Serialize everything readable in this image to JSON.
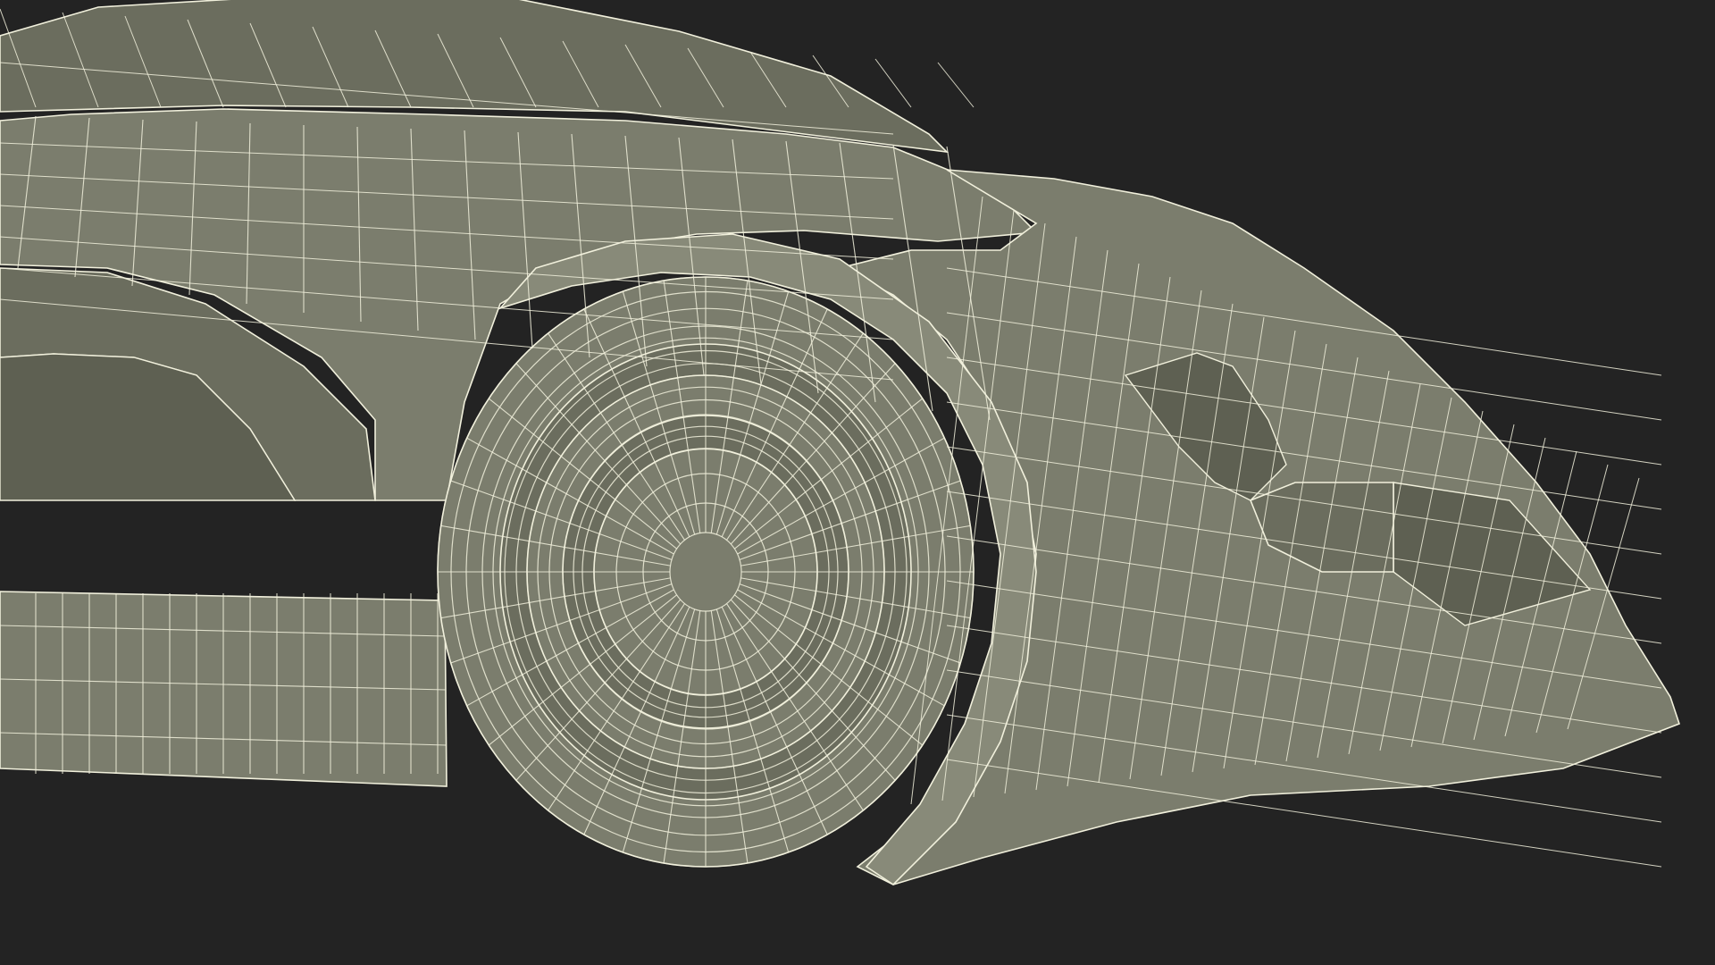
{
  "scene": {
    "subject": "",
    "background_color": "#232323",
    "surface_color": "#7B7D6D",
    "surface_shadow_color": "#6B6D5E",
    "surface_highlight_color": "#888A79",
    "wire_color": "#F1F0DC"
  }
}
